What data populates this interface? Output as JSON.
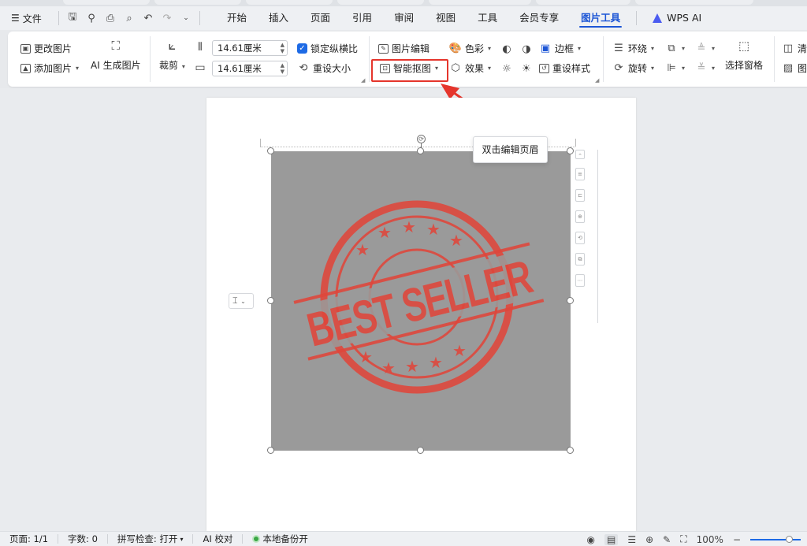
{
  "menubar": {
    "file_label": "文件",
    "tabs": [
      "开始",
      "插入",
      "页面",
      "引用",
      "审阅",
      "视图",
      "工具",
      "会员专享",
      "图片工具"
    ],
    "active_tab": "图片工具",
    "wps_ai": "WPS AI"
  },
  "ribbon": {
    "change_picture": "更改图片",
    "add_picture": "添加图片",
    "ai_generate": "AI 生成图片",
    "crop": "裁剪",
    "width_value": "14.61厘米",
    "height_value": "14.61厘米",
    "lock_ratio": "锁定纵横比",
    "reset_size": "重设大小",
    "picture_edit": "图片编辑",
    "smart_cutout": "智能抠图",
    "color": "色彩",
    "effects": "效果",
    "border": "边框",
    "reset_style": "重设样式",
    "wrap": "环绕",
    "rotate": "旋转",
    "selection_pane": "选择窗格",
    "clear_partial": "清",
    "picture_partial": "图"
  },
  "document": {
    "tooltip": "双击编辑页眉",
    "stamp_text": "BEST SELLER",
    "colors": {
      "image_bg": "#9a9a9a",
      "stamp": "#e0463b",
      "highlight": "#e5352c",
      "accent": "#1d56d6"
    }
  },
  "statusbar": {
    "page": "页面: 1/1",
    "words": "字数: 0",
    "spellcheck": "拼写检查: 打开",
    "ai_proof": "AI 校对",
    "backup": "本地备份开",
    "zoom": "100%"
  }
}
